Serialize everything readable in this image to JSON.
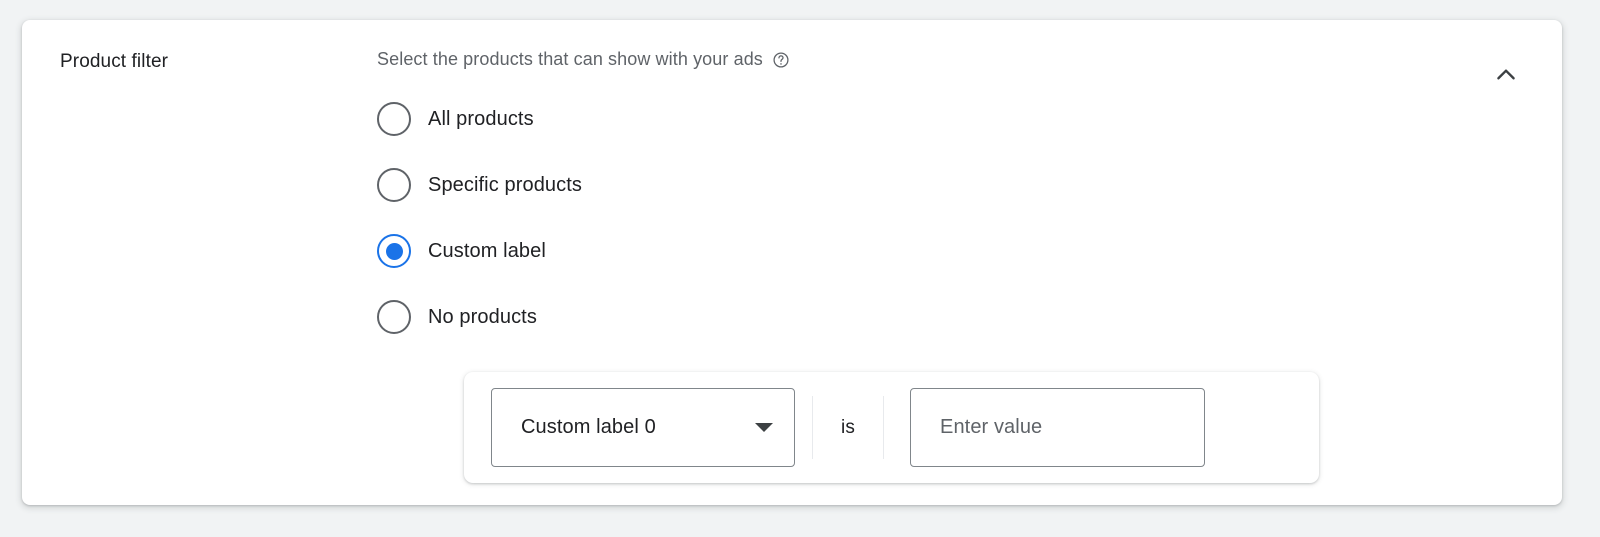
{
  "section": {
    "label": "Product filter"
  },
  "description": {
    "text": "Select the products that can show with your ads",
    "help_icon": "help-circle-icon"
  },
  "collapse": {
    "icon": "chevron-up-icon"
  },
  "radio_group": {
    "name": "product-filter",
    "selected": "Custom label",
    "options": [
      {
        "label": "All products",
        "checked": false
      },
      {
        "label": "Specific products",
        "checked": false
      },
      {
        "label": "Custom label",
        "checked": true
      },
      {
        "label": "No products",
        "checked": false
      }
    ]
  },
  "filter_row": {
    "dimension": {
      "selected": "Custom label 0",
      "icon": "chevron-down-icon"
    },
    "operator": "is",
    "value": {
      "text": "",
      "placeholder": "Enter value"
    }
  },
  "colors": {
    "accent": "#1a73e8",
    "text_primary": "#202124",
    "text_secondary": "#5f6368",
    "border": "#80868b",
    "divider": "#e8eaed",
    "page_background": "#f1f3f4",
    "card_background": "#ffffff"
  }
}
